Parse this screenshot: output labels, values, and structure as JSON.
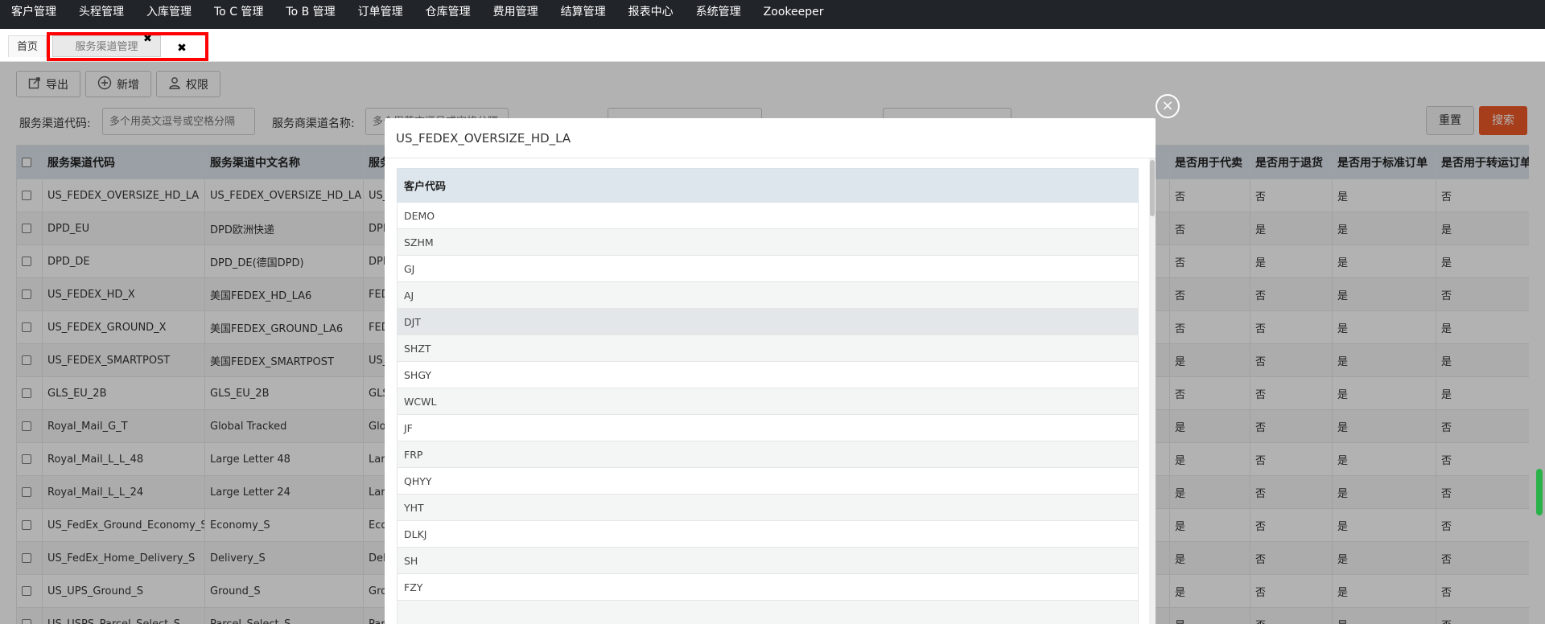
{
  "nav": {
    "items": [
      "客户管理",
      "头程管理",
      "入库管理",
      "To C 管理",
      "To B 管理",
      "订单管理",
      "仓库管理",
      "费用管理",
      "结算管理",
      "报表中心",
      "系统管理",
      "Zookeeper"
    ]
  },
  "tabs": {
    "home": "首页",
    "active": "服务渠道管理",
    "close_x": "✖",
    "close_btn": "✖"
  },
  "toolbar": {
    "export": "导出",
    "add": "新增",
    "permission": "权限"
  },
  "search": {
    "code_label": "服务渠道代码:",
    "code_placeholder": "多个用英文逗号或空格分隔",
    "provider_label": "服务商渠道名称:",
    "provider_placeholder": "多个用英文逗号或空格分隔",
    "reset": "重置",
    "search": "搜索"
  },
  "main_table": {
    "headers": [
      "服务渠道代码",
      "服务渠道中文名称",
      "服务",
      "是否用于代卖",
      "是否用于退货",
      "是否用于标准订单",
      "是否用于转运订单"
    ],
    "rows": [
      [
        "US_FEDEX_OVERSIZE_HD_LA",
        "US_FEDEX_OVERSIZE_HD_LA",
        "US_FED",
        "否",
        "否",
        "是",
        "否"
      ],
      [
        "DPD_EU",
        "DPD欧洲快递",
        "DPD_E",
        "否",
        "是",
        "是",
        "是"
      ],
      [
        "DPD_DE",
        "DPD_DE(德国DPD)",
        "DPD_D",
        "否",
        "是",
        "是",
        "是"
      ],
      [
        "US_FEDEX_HD_X",
        "美国FEDEX_HD_LA6",
        "FEDEX",
        "否",
        "否",
        "是",
        "否"
      ],
      [
        "US_FEDEX_GROUND_X",
        "美国FEDEX_GROUND_LA6",
        "FEDEX",
        "否",
        "否",
        "是",
        "是"
      ],
      [
        "US_FEDEX_SMARTPOST",
        "美国FEDEX_SMARTPOST",
        "US_FED",
        "是",
        "否",
        "是",
        "是"
      ],
      [
        "GLS_EU_2B",
        "GLS_EU_2B",
        "GLS_EU",
        "否",
        "否",
        "是",
        "是"
      ],
      [
        "Royal_Mail_G_T",
        "Global Tracked",
        "Global",
        "是",
        "否",
        "是",
        "否"
      ],
      [
        "Royal_Mail_L_L_48",
        "Large Letter 48",
        "Large L",
        "是",
        "否",
        "是",
        "否"
      ],
      [
        "Royal_Mail_L_L_24",
        "Large Letter 24",
        "Large L",
        "是",
        "否",
        "是",
        "否"
      ],
      [
        "US_FedEx_Ground_Economy_S",
        "Economy_S",
        "Econor",
        "是",
        "否",
        "是",
        "否"
      ],
      [
        "US_FedEx_Home_Delivery_S",
        "Delivery_S",
        "Deliver",
        "是",
        "否",
        "是",
        "否"
      ],
      [
        "US_UPS_Ground_S",
        "Ground_S",
        "Grounc",
        "是",
        "否",
        "是",
        "否"
      ],
      [
        "US_USPS_Parcel_Select_S",
        "Parcel_Select_S",
        "Parcel",
        "是",
        "否",
        "是",
        "否"
      ]
    ]
  },
  "modal": {
    "title": "US_FEDEX_OVERSIZE_HD_LA",
    "close": "×",
    "header": "客户代码",
    "rows": [
      "DEMO",
      "SZHM",
      "GJ",
      "AJ",
      "DJT",
      "SHZT",
      "SHGY",
      "WCWL",
      "JF",
      "FRP",
      "QHYY",
      "YHT",
      "DLKJ",
      "SH",
      "FZY",
      ""
    ]
  }
}
